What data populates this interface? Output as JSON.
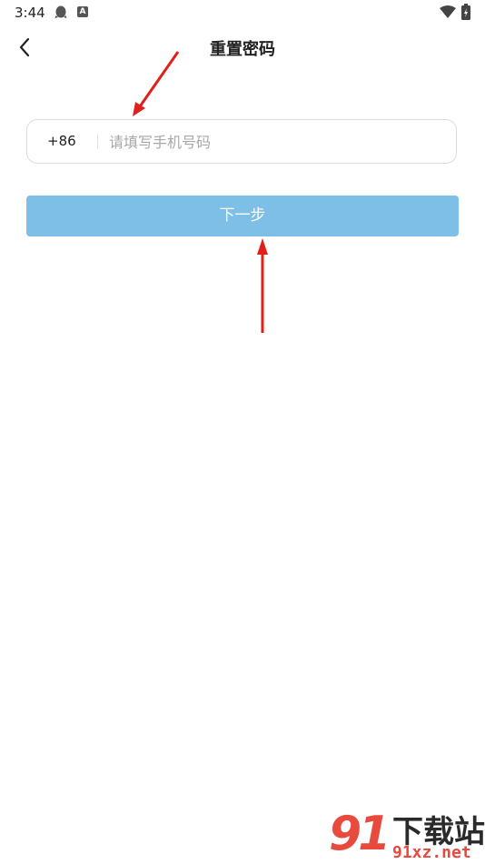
{
  "status_bar": {
    "time": "3:44",
    "notif_icons": [
      "qq-icon",
      "a-icon"
    ]
  },
  "header": {
    "title": "重置密码",
    "back_icon": "chevron-left-icon"
  },
  "phone": {
    "country_code": "+86",
    "placeholder": "请填写手机号码",
    "value": ""
  },
  "next_button": {
    "label": "下一步",
    "color": "#7dbfe7"
  },
  "annotation": {
    "arrow_color": "#e0201b"
  },
  "watermark": {
    "number": "91",
    "brand": "下载站",
    "url": "91xz.net"
  }
}
